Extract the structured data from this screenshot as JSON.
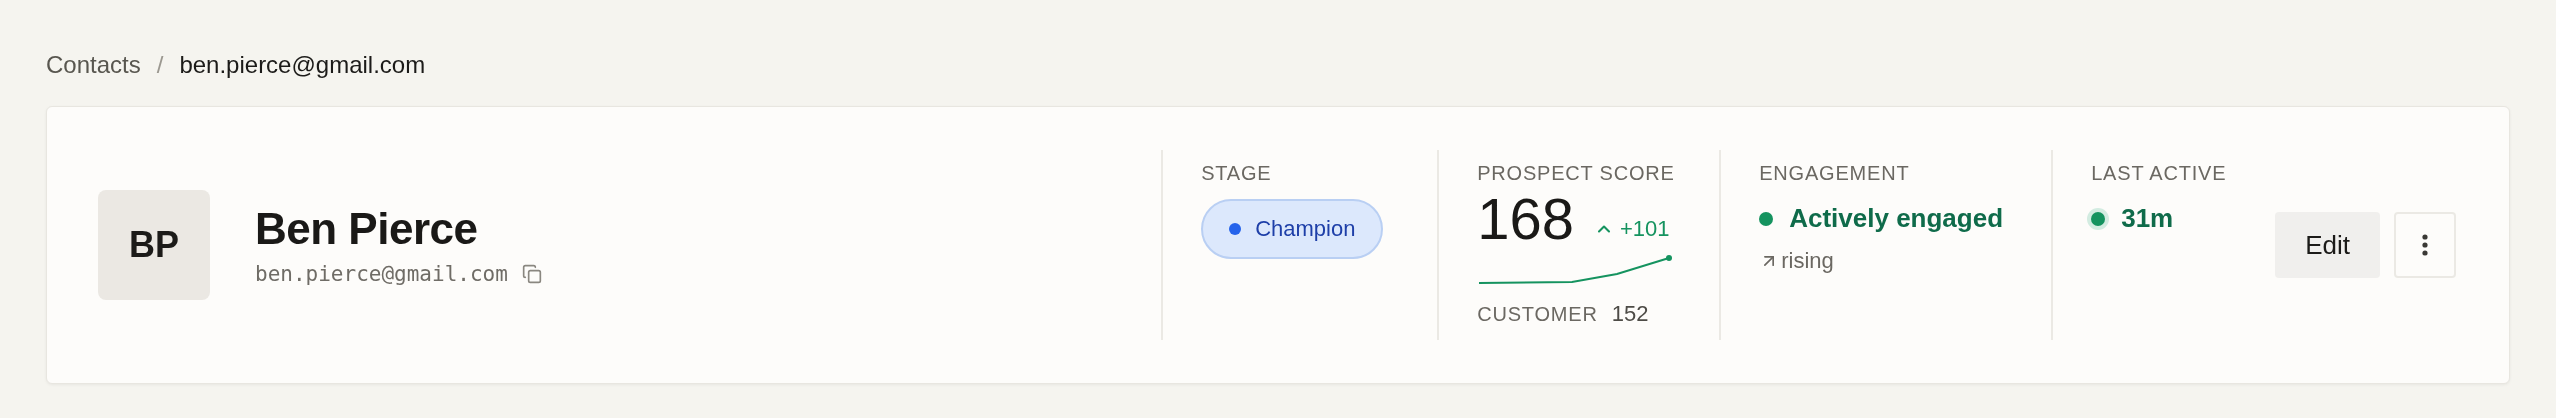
{
  "breadcrumb": {
    "items": [
      "Contacts",
      "ben.pierce@gmail.com"
    ],
    "separator": "/"
  },
  "contact": {
    "initials": "BP",
    "name": "Ben Pierce",
    "email": "ben.pierce@gmail.com"
  },
  "stage": {
    "label": "STAGE",
    "value": "Champion"
  },
  "score": {
    "label": "PROSPECT SCORE",
    "value": "168",
    "delta": "+101",
    "secondary_label": "CUSTOMER",
    "secondary_value": "152"
  },
  "engagement": {
    "label": "ENGAGEMENT",
    "status": "Actively engaged",
    "trend": "rising"
  },
  "last_active": {
    "label": "LAST ACTIVE",
    "value": "31m"
  },
  "actions": {
    "edit": "Edit"
  }
}
